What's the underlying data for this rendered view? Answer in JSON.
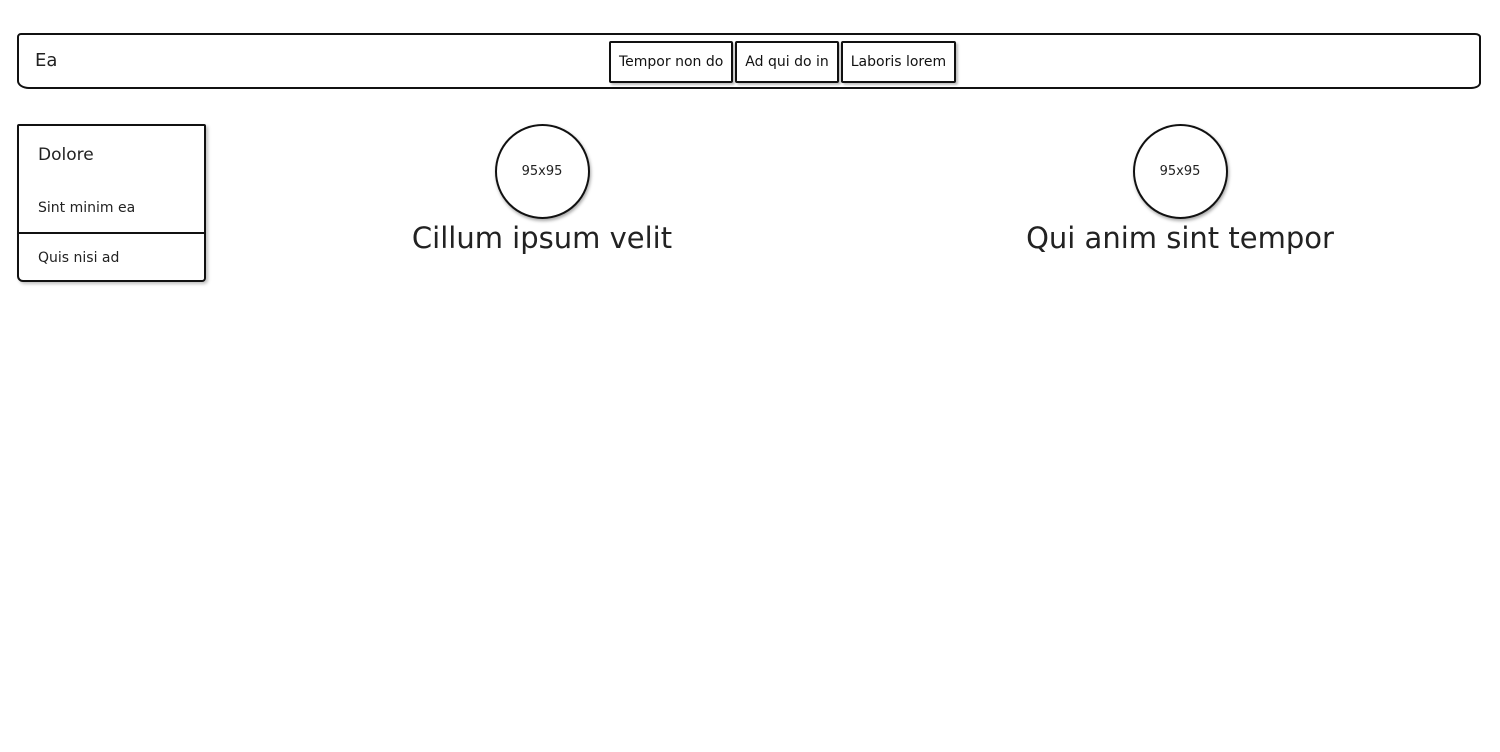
{
  "header": {
    "brand": "Ea",
    "nav": [
      {
        "label": "Tempor non do"
      },
      {
        "label": "Ad qui do in"
      },
      {
        "label": "Laboris lorem"
      }
    ]
  },
  "sidebar": {
    "title": "Dolore",
    "items": [
      {
        "label": "Sint minim ea"
      },
      {
        "label": "Quis nisi ad"
      }
    ]
  },
  "features": [
    {
      "image_label": "95x95",
      "title": "Cillum ipsum velit"
    },
    {
      "image_label": "95x95",
      "title": "Qui anim sint tempor"
    }
  ]
}
